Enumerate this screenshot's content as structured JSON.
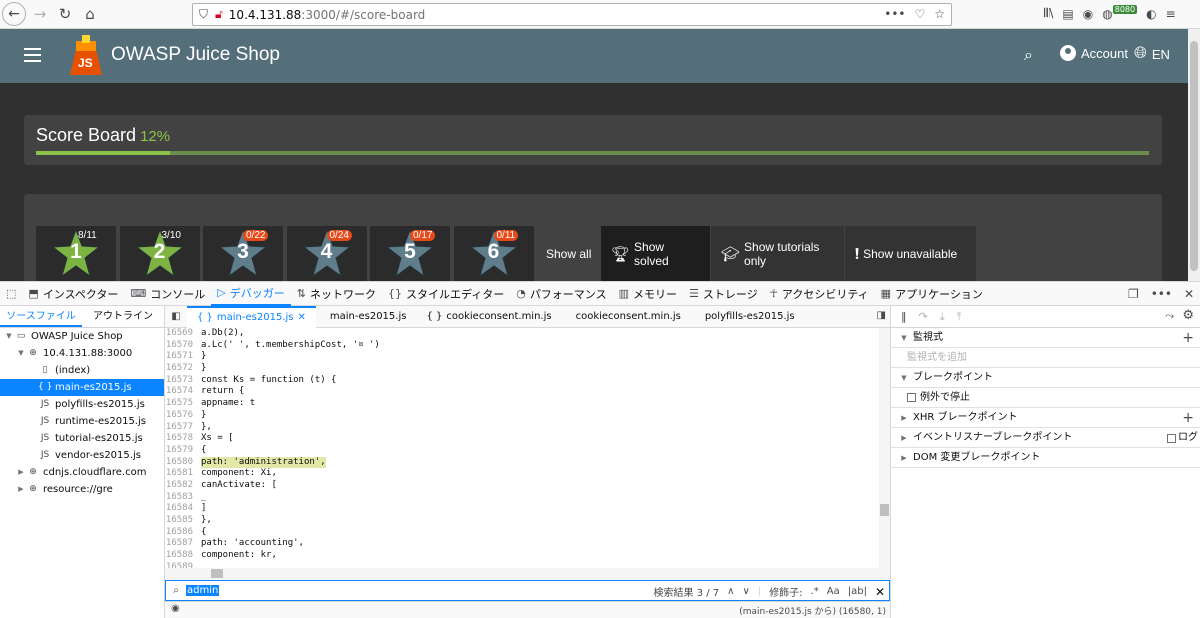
{
  "browser": {
    "url_host": "10.4.131.88",
    "url_path": ":3000/#/score-board",
    "proxy_badge": "8080"
  },
  "header": {
    "app_title": "OWASP Juice Shop",
    "account_label": "Account",
    "language_label": "EN"
  },
  "scoreboard": {
    "title": "Score Board",
    "percent_label": "12%",
    "progress_fraction": 0.12
  },
  "difficulties": [
    {
      "level": "1",
      "count": "8/11",
      "solved_style": "green"
    },
    {
      "level": "2",
      "count": "3/10",
      "solved_style": "green"
    },
    {
      "level": "3",
      "count": "0/22",
      "solved_style": "red"
    },
    {
      "level": "4",
      "count": "0/24",
      "solved_style": "red"
    },
    {
      "level": "5",
      "count": "0/17",
      "solved_style": "red"
    },
    {
      "level": "6",
      "count": "0/11",
      "solved_style": "red"
    }
  ],
  "filters": {
    "show_all": "Show all",
    "show_solved": "Show solved",
    "show_tutorials": "Show tutorials only",
    "show_unavailable": "Show unavailable"
  },
  "devtools": {
    "tabs": [
      "インスペクター",
      "コンソール",
      "デバッガー",
      "ネットワーク",
      "スタイルエディター",
      "パフォーマンス",
      "メモリー",
      "ストレージ",
      "アクセシビリティ",
      "アプリケーション"
    ],
    "active_tab": "デバッガー",
    "source_tabs": {
      "sources": "ソースファイル",
      "outline": "アウトライン"
    },
    "tree": [
      {
        "label": "OWASP Juice Shop",
        "depth": 0,
        "icon": "window-icon",
        "twisty": "▼"
      },
      {
        "label": "10.4.131.88:3000",
        "depth": 1,
        "icon": "globe-icon",
        "twisty": "▼"
      },
      {
        "label": "(index)",
        "depth": 2,
        "icon": "file-icon",
        "twisty": ""
      },
      {
        "label": "main-es2015.js",
        "depth": 2,
        "icon": "braces-icon",
        "twisty": "",
        "selected": true
      },
      {
        "label": "polyfills-es2015.js",
        "depth": 2,
        "icon": "js-icon",
        "twisty": ""
      },
      {
        "label": "runtime-es2015.js",
        "depth": 2,
        "icon": "js-icon",
        "twisty": ""
      },
      {
        "label": "tutorial-es2015.js",
        "depth": 2,
        "icon": "js-icon",
        "twisty": ""
      },
      {
        "label": "vendor-es2015.js",
        "depth": 2,
        "icon": "js-icon",
        "twisty": ""
      },
      {
        "label": "cdnjs.cloudflare.com",
        "depth": 1,
        "icon": "globe-icon",
        "twisty": "▶"
      },
      {
        "label": "resource://gre",
        "depth": 1,
        "icon": "globe-icon",
        "twisty": "▶"
      }
    ],
    "editor_tabs": [
      "main-es2015.js",
      "main-es2015.js",
      "cookieconsent.min.js",
      "cookieconsent.min.js",
      "polyfills-es2015.js"
    ],
    "code_lines": [
      {
        "n": "16569",
        "t": "a.Db(2),"
      },
      {
        "n": "16570",
        "t": "a.Lc(' ', t.membershipCost, '¤ ')"
      },
      {
        "n": "16571",
        "t": "}"
      },
      {
        "n": "16572",
        "t": "}"
      },
      {
        "n": "16573",
        "t": "const Ks = function (t) {"
      },
      {
        "n": "16574",
        "t": "return {"
      },
      {
        "n": "16575",
        "t": "appname: t"
      },
      {
        "n": "16576",
        "t": "}"
      },
      {
        "n": "16577",
        "t": "},"
      },
      {
        "n": "16578",
        "t": "Xs = ["
      },
      {
        "n": "16579",
        "t": "{"
      },
      {
        "n": "16580",
        "t": "path: 'administration',"
      },
      {
        "n": "16581",
        "t": "component: Xi,"
      },
      {
        "n": "16582",
        "t": "canActivate: ["
      },
      {
        "n": "16583",
        "t": "_"
      },
      {
        "n": "16584",
        "t": "]"
      },
      {
        "n": "16585",
        "t": "},"
      },
      {
        "n": "16586",
        "t": "{"
      },
      {
        "n": "16587",
        "t": "path: 'accounting',"
      },
      {
        "n": "16588",
        "t": "component: kr,"
      },
      {
        "n": "16589",
        "t": ""
      }
    ],
    "search_value": "admin",
    "search_results": "検索結果 3 / 7",
    "modifiers_label": "修飾子:",
    "status_position": "(main-es2015.js から)  (16580, 1)",
    "right_sections": {
      "watch": "監視式",
      "watch_placeholder": "監視式を追加",
      "breakpoints": "ブレークポイント",
      "pause_on_exceptions": "例外で停止",
      "xhr": "XHR ブレークポイント",
      "event_listener": "イベントリスナーブレークポイント",
      "event_log": "ログ",
      "dom": "DOM 変更ブレークポイント"
    }
  }
}
